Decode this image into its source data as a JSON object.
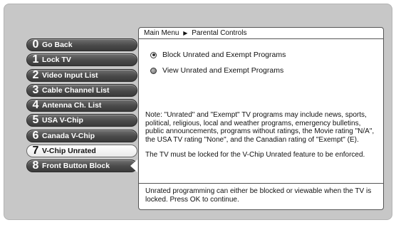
{
  "breadcrumb": {
    "root": "Main Menu",
    "separator_icon": "right-triangle-icon",
    "current": "Parental Controls"
  },
  "menu": {
    "items": [
      {
        "num": "0",
        "label": "Go Back"
      },
      {
        "num": "1",
        "label": "Lock TV"
      },
      {
        "num": "2",
        "label": "Video Input List"
      },
      {
        "num": "3",
        "label": "Cable Channel List"
      },
      {
        "num": "4",
        "label": "Antenna Ch. List"
      },
      {
        "num": "5",
        "label": "USA V-Chip"
      },
      {
        "num": "6",
        "label": "Canada V-Chip"
      },
      {
        "num": "7",
        "label": "V-Chip Unrated"
      },
      {
        "num": "8",
        "label": "Front Button Block"
      }
    ],
    "selected_index": 7
  },
  "options": [
    {
      "label": "Block Unrated and Exempt Programs",
      "selected": true
    },
    {
      "label": "View Unrated and Exempt Programs",
      "selected": false
    }
  ],
  "note": {
    "paragraph1": "Note: \"Unrated\" and \"Exempt\" TV programs may include news, sports, political, religious, local and weather programs, emergency bulletins, public announcements, programs without ratings, the Movie rating \"N/A\", the USA TV rating \"None\", and the Canadian rating of \"Exempt\" (E).",
    "paragraph2": "The TV must be locked for the V-Chip Unrated feature to be enforced."
  },
  "footer": {
    "text": "Unrated programming can either be blocked or viewable when the TV is locked. Press OK to continue."
  },
  "colors": {
    "screen_bg": "#c7c7c7",
    "button_dark": "#4a4a4a",
    "button_selected": "#ffffff",
    "panel_bg": "#ffffff"
  }
}
